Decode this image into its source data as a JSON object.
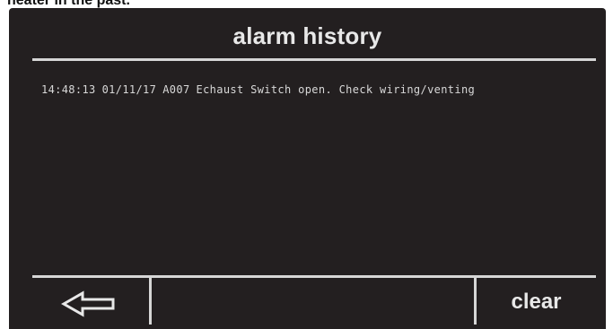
{
  "caption": "heater in the past.",
  "screen": {
    "title": "alarm history",
    "alarms": [
      {
        "time": "14:48:13",
        "date": "01/11/17",
        "code": "A007",
        "message": "Echaust Switch open. Check wiring/venting"
      }
    ]
  },
  "footer": {
    "back_icon": "left-arrow-icon",
    "clear_label": "clear"
  },
  "colors": {
    "screen_background": "#231f20",
    "text": "#e8e8e8",
    "rule": "#d6d6d6"
  }
}
